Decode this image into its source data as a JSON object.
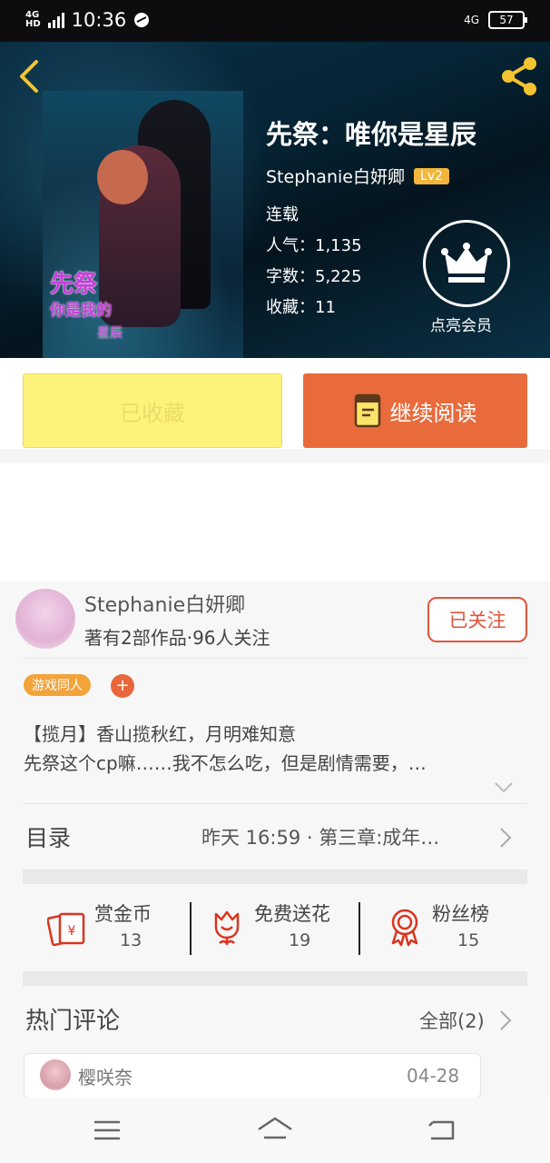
{
  "status_bar": {
    "network": "4G",
    "network_hd": "HD",
    "time": "10:36",
    "network_right": "4G",
    "battery": "57"
  },
  "book": {
    "title": "先祭：唯你是星辰",
    "author": "Stephanie白妍卿",
    "author_level": "Lv2",
    "status": "连载",
    "popularity": "人气：1,135",
    "word_count": "字数：5,225",
    "favorites": "收藏：11",
    "cover_title": "先祭",
    "cover_subtitle": "你是我的",
    "cover_subtitle2": "星辰"
  },
  "member": {
    "label": "点亮会员"
  },
  "actions": {
    "collected_label": "已收藏",
    "continue_label": "继续阅读"
  },
  "author_card": {
    "name": "Stephanie白妍卿",
    "summary": "著有2部作品·96人关注",
    "follow_label": "已关注"
  },
  "tag": {
    "label": "游戏同人",
    "add": "+"
  },
  "intro": {
    "line1": "【揽月】香山揽秋红，月明难知意",
    "line2": "先祭这个cp嘛……我不怎么吃，但是剧情需要，…"
  },
  "toc": {
    "label": "目录",
    "latest": "昨天 16:59 · 第三章:成年…"
  },
  "stats": [
    {
      "label": "赏金币",
      "value": "13",
      "icon": "red-envelope-icon"
    },
    {
      "label": "免费送花",
      "value": "19",
      "icon": "flower-icon"
    },
    {
      "label": "粉丝榜",
      "value": "15",
      "icon": "medal-icon"
    }
  ],
  "comments": {
    "label": "热门评论",
    "all_label": "全部(2)",
    "first": {
      "user": "樱咲奈",
      "date": "04-28"
    }
  },
  "colors": {
    "accent": "#e96b3c",
    "collected_bg": "#fdf27a",
    "level_badge": "#f2b63d",
    "tag": "#f2a33a",
    "follow": "#e2543a"
  }
}
